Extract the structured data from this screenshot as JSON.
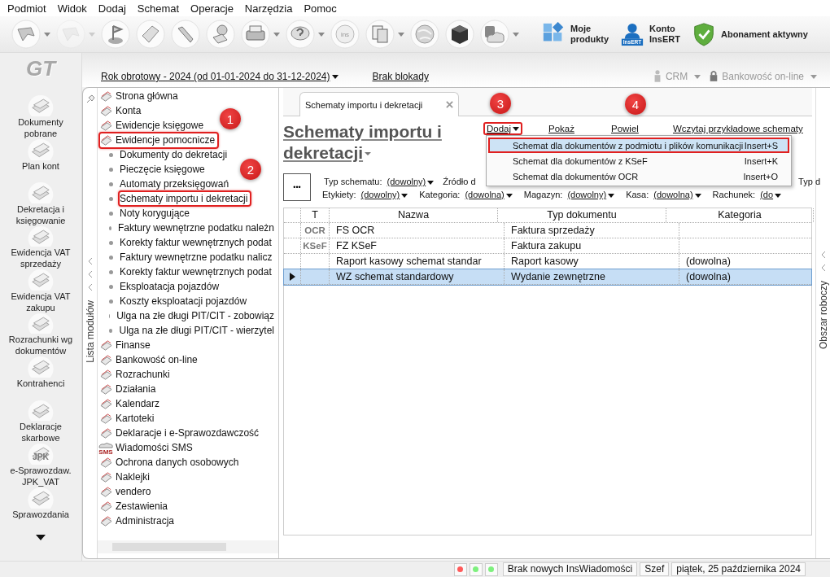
{
  "menu": [
    "Podmiot",
    "Widok",
    "Dodaj",
    "Schemat",
    "Operacje",
    "Narzędzia",
    "Pomoc"
  ],
  "toolbar": {
    "tools": [
      {
        "dropdown": true,
        "disabled": false
      },
      {
        "dropdown": true,
        "disabled": true
      },
      {
        "dropdown": false,
        "disabled": false
      },
      {
        "dropdown": false,
        "disabled": false
      },
      {
        "dropdown": false,
        "disabled": false
      },
      {
        "dropdown": false,
        "disabled": false
      },
      {
        "dropdown": true,
        "disabled": false
      },
      {
        "dropdown": true,
        "disabled": false
      },
      {
        "dropdown": false,
        "disabled": false,
        "icon_text": "ins"
      },
      {
        "dropdown": true,
        "disabled": false
      },
      {
        "dropdown": false,
        "disabled": false
      },
      {
        "dropdown": false,
        "disabled": false
      },
      {
        "dropdown": true,
        "disabled": false
      }
    ],
    "shortcuts": [
      {
        "lines": [
          "Moje",
          "produkty"
        ]
      },
      {
        "lines": [
          "Konto",
          "InsERT"
        ],
        "icon_text": "InsERT"
      },
      {
        "lines": [
          "Abonament aktywny"
        ]
      }
    ]
  },
  "logo": "GT",
  "modules": [
    {
      "label": "Dokumenty pobrane"
    },
    {
      "label": "Plan kont"
    },
    {
      "label": "Dekretacja i księgowanie"
    },
    {
      "label": "Ewidencja VAT sprzedaży"
    },
    {
      "label": "Ewidencja VAT zakupu"
    },
    {
      "label": "Rozrachunki wg dokumentów"
    },
    {
      "label": "Kontrahenci"
    },
    {
      "label": "Deklaracje skarbowe"
    },
    {
      "label": "e-Sprawozdaw. JPK_VAT",
      "icon_text": "JPK"
    },
    {
      "label": "Sprawozdania"
    }
  ],
  "topbar": {
    "fiscal_year": "Rok obrotowy - 2024  (od 01-01-2024 do 31-12-2024)",
    "lock": "Brak blokady",
    "crm": "CRM",
    "banking": "Bankowość on-line"
  },
  "module_list_label": "Lista modułów",
  "tree": [
    {
      "label": "Strona główna",
      "highlighted": false
    },
    {
      "label": "Konta",
      "highlighted": false
    },
    {
      "label": "Ewidencje księgowe",
      "highlighted": false,
      "marker": "1"
    },
    {
      "label": "Ewidencje pomocnicze",
      "highlighted": true,
      "children": [
        {
          "label": "Dokumenty do dekretacji",
          "highlighted": false
        },
        {
          "label": "Pieczęcie księgowe",
          "highlighted": false,
          "marker": "2"
        },
        {
          "label": "Automaty przeksięgowań",
          "highlighted": false
        },
        {
          "label": "Schematy importu i dekretacji",
          "highlighted": true
        },
        {
          "label": "Noty korygujące",
          "highlighted": false
        },
        {
          "label": "Faktury wewnętrzne podatku należn",
          "highlighted": false
        },
        {
          "label": "Korekty faktur wewnętrznych podat",
          "highlighted": false
        },
        {
          "label": "Faktury wewnętrzne podatku nalicz",
          "highlighted": false
        },
        {
          "label": "Korekty faktur wewnętrznych podat",
          "highlighted": false
        },
        {
          "label": "Eksploatacja pojazdów",
          "highlighted": false
        },
        {
          "label": "Koszty eksploatacji pojazdów",
          "highlighted": false
        },
        {
          "label": "Ulga na złe długi PIT/CIT - zobowiąz",
          "highlighted": false
        },
        {
          "label": "Ulga na złe długi PIT/CIT - wierzytel",
          "highlighted": false
        }
      ]
    },
    {
      "label": "Finanse",
      "highlighted": false
    },
    {
      "label": "Bankowość on-line",
      "highlighted": false
    },
    {
      "label": "Rozrachunki",
      "highlighted": false
    },
    {
      "label": "Działania",
      "highlighted": false
    },
    {
      "label": "Kalendarz",
      "highlighted": false
    },
    {
      "label": "Kartoteki",
      "highlighted": false
    },
    {
      "label": "Deklaracje i e-Sprawozdawczość",
      "highlighted": false
    },
    {
      "label": "Wiadomości SMS",
      "highlighted": false,
      "icon_text": "SMS"
    },
    {
      "label": "Ochrona danych osobowych",
      "highlighted": false
    },
    {
      "label": "Naklejki",
      "highlighted": false
    },
    {
      "label": "vendero",
      "highlighted": false
    },
    {
      "label": "Zestawienia",
      "highlighted": false
    },
    {
      "label": "Administracja",
      "highlighted": false
    }
  ],
  "tab": {
    "label": "Schematy importu i dekretacji"
  },
  "title": "Schematy importu i dekretacji",
  "links": [
    {
      "label": "Dodaj",
      "dropdown": true,
      "highlighted": true,
      "marker": "3"
    },
    {
      "label": "Pokaż",
      "dropdown": false,
      "highlighted": false
    },
    {
      "label": "Powiel",
      "dropdown": false,
      "highlighted": false,
      "marker": "4"
    },
    {
      "label": "Wczytaj przykładowe schematy",
      "dropdown": false,
      "highlighted": false
    }
  ],
  "dropdown_menu": [
    {
      "label": "Schemat dla dokumentów z podmiotu i plików komunikacji",
      "shortcut": "Insert+S",
      "selected": true,
      "highlighted": true
    },
    {
      "label": "Schemat dla dokumentów z KSeF",
      "shortcut": "Insert+K",
      "selected": false,
      "highlighted": false
    },
    {
      "label": "Schemat dla dokumentów OCR",
      "shortcut": "Insert+O",
      "selected": false,
      "highlighted": false
    }
  ],
  "more_button": "•••",
  "filters": [
    [
      {
        "label": "Typ schematu:",
        "value": "(dowolny)"
      },
      {
        "label": "Źródło d"
      },
      {
        "label": "Typ d"
      }
    ],
    [
      {
        "label": "Etykiety:",
        "value": "(dowolny)"
      },
      {
        "label": "Kategoria:",
        "value": "(dowolna)"
      },
      {
        "label": "Magazyn:",
        "value": "(dowolny)"
      },
      {
        "label": "Kasa:",
        "value": "(dowolna)"
      },
      {
        "label": "Rachunek:",
        "value": "(do"
      }
    ]
  ],
  "table": {
    "columns": [
      "T",
      "Nazwa",
      "Typ dokumentu",
      "Kategoria"
    ],
    "rows": [
      {
        "type": "OCR",
        "name": "FS OCR",
        "doc_type": "Faktura sprzedaży",
        "selected": false
      },
      {
        "type": "KSeF",
        "name": "FZ KSeF",
        "doc_type": "Faktura zakupu",
        "selected": false
      },
      {
        "name": "Raport kasowy schemat standar",
        "doc_type": "Raport kasowy",
        "category": "(dowolna)",
        "selected": false
      },
      {
        "name": "WZ schemat standardowy",
        "doc_type": "Wydanie zewnętrzne",
        "category": "(dowolna)",
        "selected": true
      }
    ]
  },
  "workspace_label": "Obszar roboczy",
  "status_bar": {
    "lights": [
      {
        "color": "#ff5a5a"
      },
      {
        "color": "#7ef07e"
      },
      {
        "color": "#7ef07e"
      }
    ],
    "texts": [
      "Brak nowych InsWiadomości",
      "Szef",
      "piątek, 25 października 2024"
    ]
  }
}
